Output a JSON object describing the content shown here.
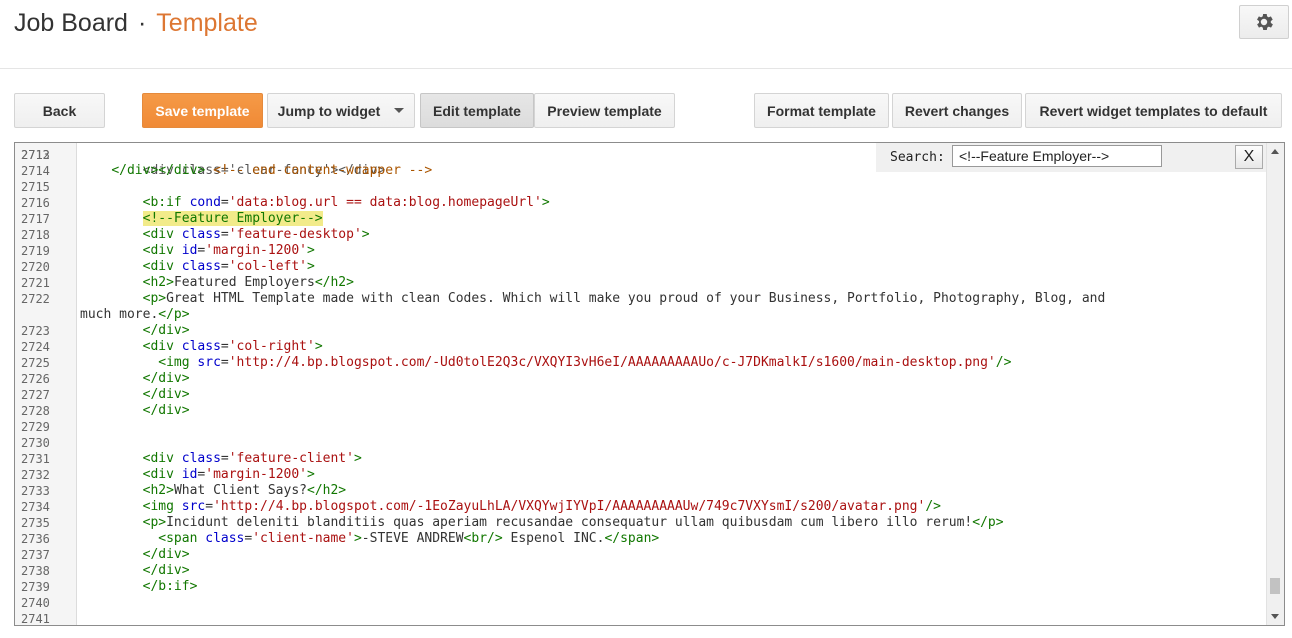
{
  "header": {
    "title": "Job Board",
    "separator": "·",
    "page": "Template"
  },
  "toolbar": {
    "back": "Back",
    "save": "Save template",
    "jump": "Jump to widget",
    "edit": "Edit template",
    "preview": "Preview template",
    "format": "Format template",
    "revert": "Revert changes",
    "revert_widgets": "Revert widget templates to default"
  },
  "search": {
    "label": "Search:",
    "value": "<!--Feature Employer-->",
    "close": "X"
  },
  "colors": {
    "accent": "#dd7733",
    "save_button": "#f08a36"
  },
  "code": [
    {
      "n": "2713",
      "s": []
    },
    {
      "n": "2714",
      "s": [
        [
          "t",
          "    "
        ],
        [
          "tag",
          "</div></div>"
        ],
        [
          "t",
          " "
        ],
        [
          "cmt",
          "<!-- end content-wrapper -->"
        ]
      ]
    },
    {
      "n": "2715",
      "s": []
    },
    {
      "n": "2716",
      "s": [
        [
          "t",
          "        "
        ],
        [
          "tag",
          "<b:if"
        ],
        [
          "t",
          " "
        ],
        [
          "attr",
          "cond"
        ],
        [
          "t",
          "="
        ],
        [
          "str",
          "'data:blog.url == data:blog.homepageUrl'"
        ],
        [
          "tag",
          ">"
        ]
      ]
    },
    {
      "n": "2717",
      "s": [
        [
          "t",
          "        "
        ],
        [
          "hl",
          "<!--Feature Employer-->"
        ]
      ]
    },
    {
      "n": "2718",
      "s": [
        [
          "t",
          "        "
        ],
        [
          "tag",
          "<div"
        ],
        [
          "t",
          " "
        ],
        [
          "attr",
          "class"
        ],
        [
          "t",
          "="
        ],
        [
          "str",
          "'feature-desktop'"
        ],
        [
          "tag",
          ">"
        ]
      ]
    },
    {
      "n": "2719",
      "s": [
        [
          "t",
          "        "
        ],
        [
          "tag",
          "<div"
        ],
        [
          "t",
          " "
        ],
        [
          "attr",
          "id"
        ],
        [
          "t",
          "="
        ],
        [
          "str",
          "'margin-1200'"
        ],
        [
          "tag",
          ">"
        ]
      ]
    },
    {
      "n": "2720",
      "s": [
        [
          "t",
          "        "
        ],
        [
          "tag",
          "<div"
        ],
        [
          "t",
          " "
        ],
        [
          "attr",
          "class"
        ],
        [
          "t",
          "="
        ],
        [
          "str",
          "'col-left'"
        ],
        [
          "tag",
          ">"
        ]
      ]
    },
    {
      "n": "2721",
      "s": [
        [
          "t",
          "        "
        ],
        [
          "tag",
          "<h2>"
        ],
        [
          "t",
          "Featured Employers"
        ],
        [
          "tag",
          "</h2>"
        ]
      ]
    },
    {
      "n": "2722",
      "s": [
        [
          "t",
          "        "
        ],
        [
          "tag",
          "<p>"
        ],
        [
          "t",
          "Great HTML Template made with clean Codes. Which will make you proud of your Business, Portfolio, Photography, Blog, and"
        ]
      ]
    },
    {
      "n": "",
      "s": [
        [
          "t",
          "much more."
        ],
        [
          "tag",
          "</p>"
        ]
      ]
    },
    {
      "n": "2723",
      "s": [
        [
          "t",
          "        "
        ],
        [
          "tag",
          "</div>"
        ]
      ]
    },
    {
      "n": "2724",
      "s": [
        [
          "t",
          "        "
        ],
        [
          "tag",
          "<div"
        ],
        [
          "t",
          " "
        ],
        [
          "attr",
          "class"
        ],
        [
          "t",
          "="
        ],
        [
          "str",
          "'col-right'"
        ],
        [
          "tag",
          ">"
        ]
      ]
    },
    {
      "n": "2725",
      "s": [
        [
          "t",
          "          "
        ],
        [
          "tag",
          "<img"
        ],
        [
          "t",
          " "
        ],
        [
          "attr",
          "src"
        ],
        [
          "t",
          "="
        ],
        [
          "str",
          "'http://4.bp.blogspot.com/-Ud0tolE2Q3c/VXQYI3vH6eI/AAAAAAAAAUo/c-J7DKmalkI/s1600/main-desktop.png'"
        ],
        [
          "tag",
          "/>"
        ]
      ]
    },
    {
      "n": "2726",
      "s": [
        [
          "t",
          "        "
        ],
        [
          "tag",
          "</div>"
        ]
      ]
    },
    {
      "n": "2727",
      "s": [
        [
          "t",
          "        "
        ],
        [
          "tag",
          "</div>"
        ]
      ]
    },
    {
      "n": "2728",
      "s": [
        [
          "t",
          "        "
        ],
        [
          "tag",
          "</div>"
        ]
      ]
    },
    {
      "n": "2729",
      "s": []
    },
    {
      "n": "2730",
      "s": []
    },
    {
      "n": "2731",
      "s": [
        [
          "t",
          "        "
        ],
        [
          "tag",
          "<div"
        ],
        [
          "t",
          " "
        ],
        [
          "attr",
          "class"
        ],
        [
          "t",
          "="
        ],
        [
          "str",
          "'feature-client'"
        ],
        [
          "tag",
          ">"
        ]
      ]
    },
    {
      "n": "2732",
      "s": [
        [
          "t",
          "        "
        ],
        [
          "tag",
          "<div"
        ],
        [
          "t",
          " "
        ],
        [
          "attr",
          "id"
        ],
        [
          "t",
          "="
        ],
        [
          "str",
          "'margin-1200'"
        ],
        [
          "tag",
          ">"
        ]
      ]
    },
    {
      "n": "2733",
      "s": [
        [
          "t",
          "        "
        ],
        [
          "tag",
          "<h2>"
        ],
        [
          "t",
          "What Client Says?"
        ],
        [
          "tag",
          "</h2>"
        ]
      ]
    },
    {
      "n": "2734",
      "s": [
        [
          "t",
          "        "
        ],
        [
          "tag",
          "<img"
        ],
        [
          "t",
          " "
        ],
        [
          "attr",
          "src"
        ],
        [
          "t",
          "="
        ],
        [
          "str",
          "'http://4.bp.blogspot.com/-1EoZayuLhLA/VXQYwjIYVpI/AAAAAAAAAUw/749c7VXYsmI/s200/avatar.png'"
        ],
        [
          "tag",
          "/>"
        ]
      ]
    },
    {
      "n": "2735",
      "s": [
        [
          "t",
          "        "
        ],
        [
          "tag",
          "<p>"
        ],
        [
          "t",
          "Incidunt deleniti blanditiis quas aperiam recusandae consequatur ullam quibusdam cum libero illo rerum!"
        ],
        [
          "tag",
          "</p>"
        ]
      ]
    },
    {
      "n": "2736",
      "s": [
        [
          "t",
          "          "
        ],
        [
          "tag",
          "<span"
        ],
        [
          "t",
          " "
        ],
        [
          "attr",
          "class"
        ],
        [
          "t",
          "="
        ],
        [
          "str",
          "'client-name'"
        ],
        [
          "tag",
          ">"
        ],
        [
          "t",
          "-STEVE ANDREW"
        ],
        [
          "tag",
          "<br/>"
        ],
        [
          "t",
          " Espenol INC."
        ],
        [
          "tag",
          "</span>"
        ]
      ]
    },
    {
      "n": "2737",
      "s": [
        [
          "t",
          "        "
        ],
        [
          "tag",
          "</div>"
        ]
      ]
    },
    {
      "n": "2738",
      "s": [
        [
          "t",
          "        "
        ],
        [
          "tag",
          "</div>"
        ]
      ]
    },
    {
      "n": "2739",
      "s": [
        [
          "t",
          "        "
        ],
        [
          "tag",
          "</b:if>"
        ]
      ]
    },
    {
      "n": "2740",
      "s": []
    },
    {
      "n": "2741",
      "s": []
    }
  ]
}
